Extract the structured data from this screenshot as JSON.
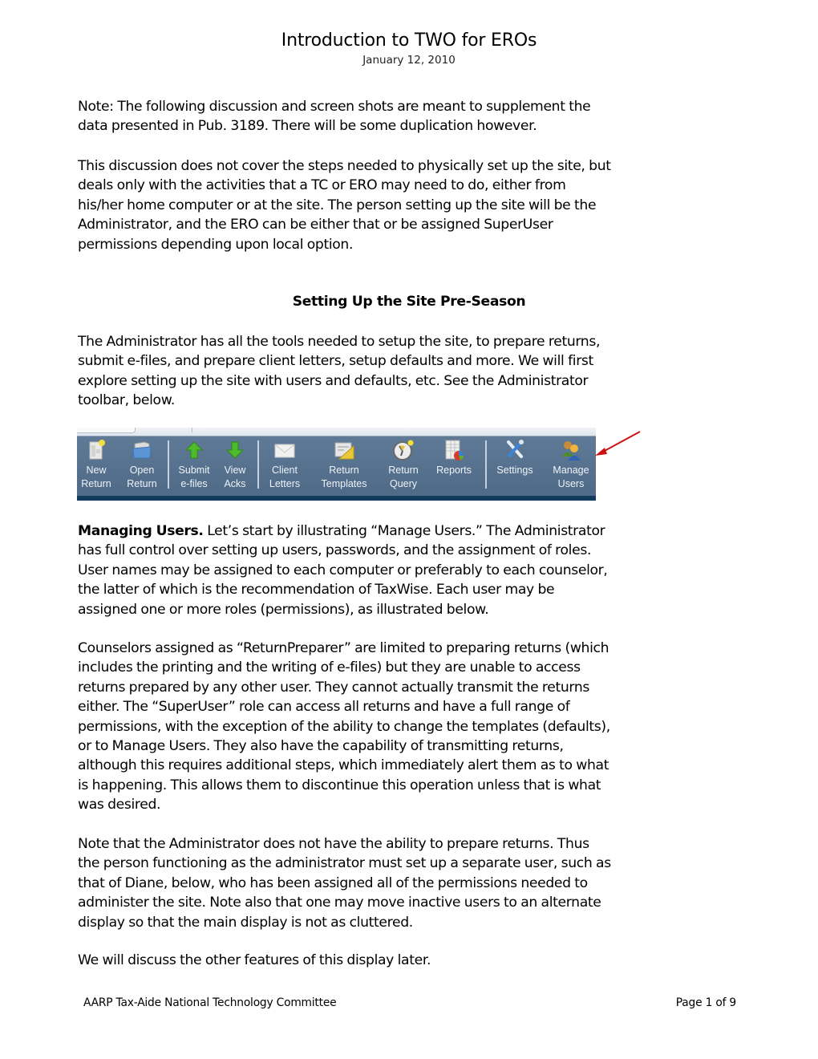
{
  "document": {
    "title": "Introduction to TWO for EROs",
    "date": "January 12, 2010",
    "paragraphs": {
      "note": [
        "Note:  The following discussion and screen shots are meant to supplement the",
        "data presented in Pub. 3189.  There will be some duplication however."
      ],
      "scope": [
        "This discussion does not cover the steps needed to physically set up the site, but",
        "deals only with the activities that a TC or ERO may need to do, either from",
        "his/her home computer or at the site.  The person setting up the site will be the",
        "Administrator, and the ERO can be either that or be assigned SuperUser",
        "permissions depending upon local option."
      ],
      "section_heading": "Setting Up the Site Pre-Season",
      "admin_tools": [
        "The Administrator has all the tools needed to setup the site, to prepare returns,",
        "submit e-files, and prepare client letters, setup defaults and more.  We will first",
        "explore setting up the site with users and defaults, etc. See the Administrator",
        "toolbar, below."
      ],
      "managing_users_lead": "Managing Users.",
      "managing_users": [
        " Let’s start by illustrating “Manage Users.”  The Administrator",
        "has full control over setting up users, passwords, and the assignment of roles.",
        "User names may be assigned to each computer or preferably to each counselor,",
        "the latter of which is the recommendation of TaxWise.  Each user may be",
        "assigned one or more roles (permissions), as illustrated below."
      ],
      "counselors": [
        "Counselors assigned as “ReturnPreparer” are limited to preparing returns (which",
        "includes the printing and the writing of e-files) but they are unable to access",
        "returns prepared by any other user.  They cannot actually transmit the returns",
        "either.  The “SuperUser” role can access all returns and have a full range of",
        "permissions, with the exception of the ability to change the templates (defaults),",
        "or to Manage Users. They also have the capability of transmitting returns,",
        "although this requires additional steps, which immediately alert them as to what",
        "is happening.  This allows them to discontinue this operation unless that is what",
        "was desired."
      ],
      "admin_note": [
        "Note that the Administrator does not have the ability to prepare returns.  Thus",
        "the person functioning as the administrator must set up a separate user, such as",
        "that of Diane, below, who has been assigned all of the permissions needed to",
        "administer the site.  Note also that one may move inactive users to an alternate",
        "display so that the main display is not as cluttered."
      ],
      "closing": [
        "We will discuss the other features of this display later."
      ]
    }
  },
  "toolbar": {
    "background": "#56718e",
    "buttons": [
      {
        "id": "new-return",
        "line1": "New",
        "line2": "Return",
        "icon": "new-document-icon"
      },
      {
        "id": "open-return",
        "line1": "Open",
        "line2": "Return",
        "icon": "folder-icon"
      },
      {
        "id": "submit-efiles",
        "line1": "Submit",
        "line2": "e-files",
        "icon": "arrow-up-icon"
      },
      {
        "id": "view-acks",
        "line1": "View",
        "line2": "Acks",
        "icon": "arrow-down-icon"
      },
      {
        "id": "client-letters",
        "line1": "Client",
        "line2": "Letters",
        "icon": "envelope-icon"
      },
      {
        "id": "return-templates",
        "line1": "Return",
        "line2": "Templates",
        "icon": "template-ruler-icon"
      },
      {
        "id": "return-query",
        "line1": "Return",
        "line2": "Query",
        "icon": "clock-icon"
      },
      {
        "id": "reports",
        "line1": "Reports",
        "line2": "",
        "icon": "report-chart-icon"
      },
      {
        "id": "settings",
        "line1": "Settings",
        "line2": "",
        "icon": "wrench-screwdriver-icon"
      },
      {
        "id": "manage-users",
        "line1": "Manage",
        "line2": "Users",
        "icon": "users-icon"
      }
    ]
  },
  "annotation": {
    "arrow_color": "#cc1111",
    "points_to": "manage-users"
  },
  "footer": {
    "left": "AARP Tax-Aide National Technology Committee",
    "right": "Page 1 of 9"
  }
}
